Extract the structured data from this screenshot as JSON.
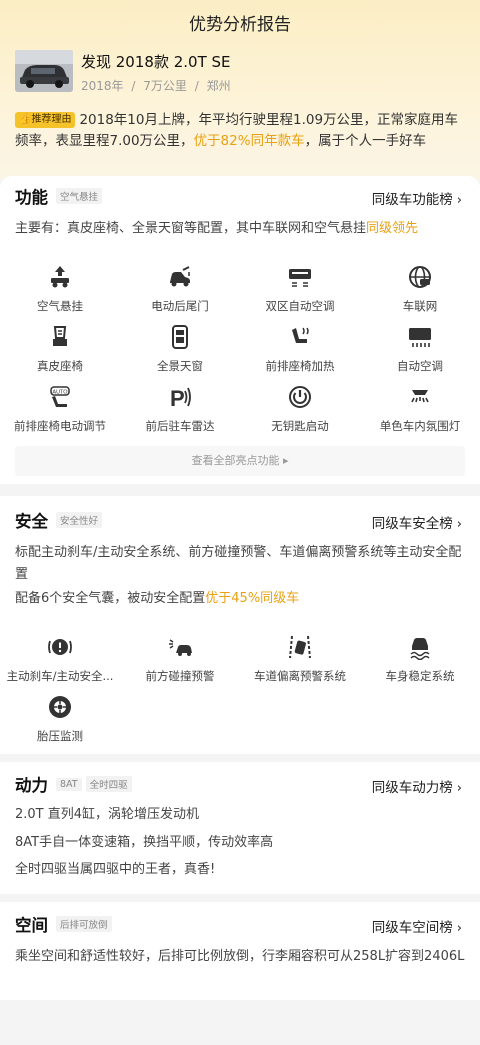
{
  "header": {
    "title": "优势分析报告"
  },
  "car": {
    "name": "发现 2018款 2.0T SE",
    "year": "2018年",
    "mileage": "7万公里",
    "city": "郑州",
    "separator": "/"
  },
  "reason": {
    "badge": "推荐理由",
    "text_before": "2018年10月上牌，年平均行驶里程1.09万公里，正常家庭用车频率，表显里程7.00万公里，",
    "highlight": "优于82%同年款车",
    "text_after": "，属于个人一手好车"
  },
  "function": {
    "title": "功能",
    "tag": "空气悬挂",
    "rank_link": "同级车功能榜",
    "desc_before": "主要有：真皮座椅、全景天窗等配置，其中车联网和空气悬挂",
    "desc_highlight": "同级领先",
    "features": [
      {
        "label": "空气悬挂",
        "icon": "air-suspension-icon"
      },
      {
        "label": "电动后尾门",
        "icon": "power-tailgate-icon"
      },
      {
        "label": "双区自动空调",
        "icon": "dual-zone-ac-icon"
      },
      {
        "label": "车联网",
        "icon": "connected-car-icon"
      },
      {
        "label": "真皮座椅",
        "icon": "leather-seat-icon"
      },
      {
        "label": "全景天窗",
        "icon": "panoramic-sunroof-icon"
      },
      {
        "label": "前排座椅加热",
        "icon": "seat-heating-icon"
      },
      {
        "label": "自动空调",
        "icon": "auto-ac-icon"
      },
      {
        "label": "前排座椅电动调节",
        "icon": "power-seat-icon"
      },
      {
        "label": "前后驻车雷达",
        "icon": "parking-radar-icon"
      },
      {
        "label": "无钥匙启动",
        "icon": "keyless-start-icon"
      },
      {
        "label": "单色车内氛围灯",
        "icon": "ambient-light-icon"
      }
    ],
    "view_all": "查看全部亮点功能 ▸"
  },
  "safety": {
    "title": "安全",
    "tag": "安全性好",
    "rank_link": "同级车安全榜",
    "desc1": "标配主动刹车/主动安全系统、前方碰撞预警、车道偏离预警系统等主动安全配置",
    "desc2_before": "配备6个安全气囊，被动安全配置",
    "desc2_highlight": "优于45%同级车",
    "features": [
      {
        "label": "主动刹车/主动安全...",
        "icon": "active-brake-icon"
      },
      {
        "label": "前方碰撞预警",
        "icon": "collision-warning-icon"
      },
      {
        "label": "车道偏离预警系统",
        "icon": "lane-departure-icon"
      },
      {
        "label": "车身稳定系统",
        "icon": "stability-control-icon"
      },
      {
        "label": "胎压监测",
        "icon": "tire-pressure-icon"
      }
    ]
  },
  "power": {
    "title": "动力",
    "tags": [
      "8AT",
      "全时四驱"
    ],
    "rank_link": "同级车动力榜",
    "lines": [
      "2.0T 直列4缸，涡轮增压发动机",
      "8AT手自一体变速箱，换挡平顺，传动效率高",
      "全时四驱当属四驱中的王者，真香!"
    ]
  },
  "space": {
    "title": "空间",
    "tag": "后排可放倒",
    "rank_link": "同级车空间榜",
    "desc": "乘坐空间和舒适性较好，后排可比例放倒，行李厢容积可从258L扩容到2406L"
  },
  "colors": {
    "accent": "#e8a112",
    "badge": "#f6c229"
  }
}
